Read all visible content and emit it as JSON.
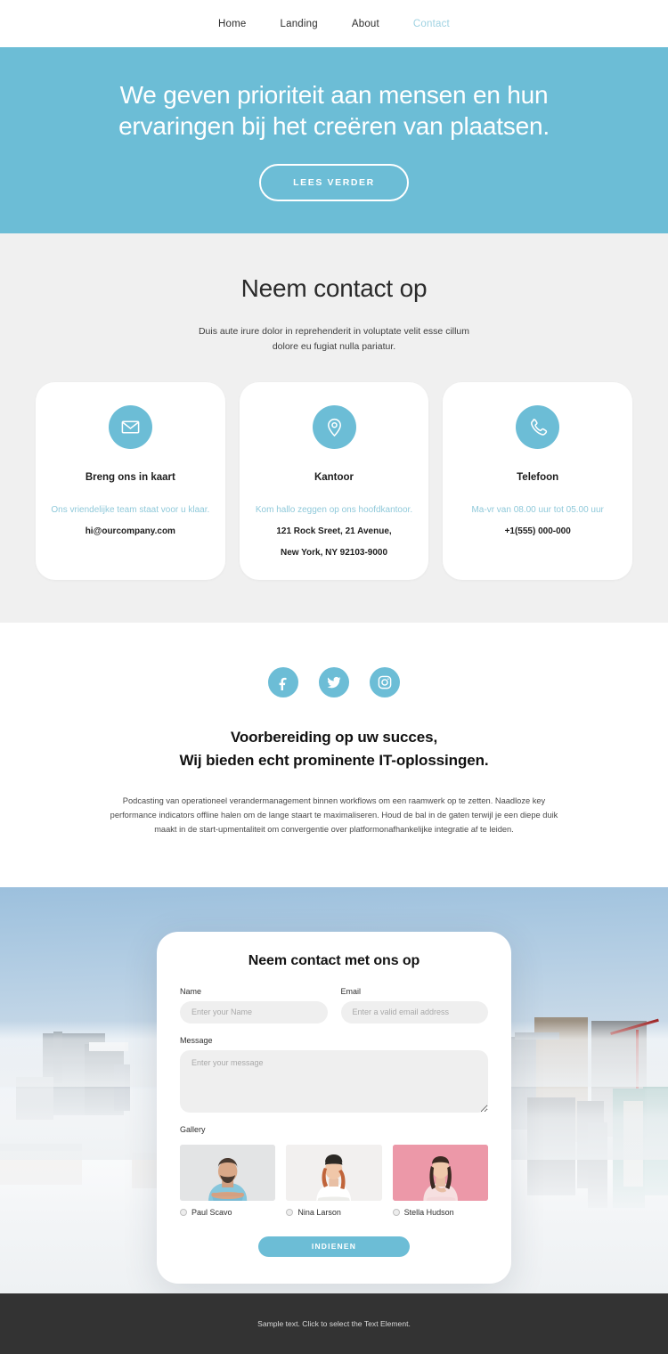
{
  "nav": {
    "items": [
      {
        "label": "Home",
        "active": false
      },
      {
        "label": "Landing",
        "active": false
      },
      {
        "label": "About",
        "active": false
      },
      {
        "label": "Contact",
        "active": true
      }
    ]
  },
  "hero": {
    "title": "We geven prioriteit aan mensen en hun ervaringen bij het creëren van plaatsen.",
    "button": "LEES VERDER",
    "bg_color": "#6cbdd6"
  },
  "contact": {
    "title": "Neem contact op",
    "subtitle": "Duis aute irure dolor in reprehenderit in voluptate velit esse cillum dolore eu fugiat nulla pariatur.",
    "cards": [
      {
        "icon": "envelope-icon",
        "title": "Breng ons in kaart",
        "sub": "Ons vriendelijke team staat voor u klaar.",
        "value": "hi@ourcompany.com",
        "value2": ""
      },
      {
        "icon": "map-pin-icon",
        "title": "Kantoor",
        "sub": "Kom hallo zeggen op ons hoofdkantoor.",
        "value": "121 Rock Sreet, 21 Avenue,",
        "value2": "New York, NY 92103-9000"
      },
      {
        "icon": "phone-icon",
        "title": "Telefoon",
        "sub": "Ma-vr van 08.00 uur tot 05.00 uur",
        "value": "+1(555) 000-000",
        "value2": ""
      }
    ]
  },
  "mid": {
    "socials": [
      {
        "icon": "facebook-icon",
        "name": "Facebook"
      },
      {
        "icon": "twitter-icon",
        "name": "Twitter"
      },
      {
        "icon": "instagram-icon",
        "name": "Instagram"
      }
    ],
    "title_line1": "Voorbereiding op uw succes,",
    "title_line2": "Wij bieden echt prominente IT-oplossingen.",
    "paragraph": "Podcasting van operationeel verandermanagement binnen workflows om een raamwerk op te zetten. Naadloze key performance indicators offline halen om de lange staart te maximaliseren. Houd de bal in de gaten terwijl je een diepe duik maakt in de start-upmentaliteit om convergentie over platformonafhankelijke integratie af te leiden."
  },
  "form": {
    "title": "Neem contact met ons op",
    "name_label": "Name",
    "name_placeholder": "Enter your Name",
    "name_value": "",
    "email_label": "Email",
    "email_placeholder": "Enter a valid email address",
    "email_value": "",
    "message_label": "Message",
    "message_placeholder": "Enter your message",
    "message_value": "",
    "gallery_label": "Gallery",
    "gallery": [
      {
        "name": "Paul Scavo",
        "bg": "#e2e3e4",
        "selected": false
      },
      {
        "name": "Nina Larson",
        "bg": "#f1efee",
        "selected": false
      },
      {
        "name": "Stella Hudson",
        "bg": "#eb97a7",
        "selected": false
      }
    ],
    "submit": "INDIENEN",
    "accent_color": "#6cbdd6"
  },
  "footer": {
    "text": "Sample text. Click to select the Text Element.",
    "bg_color": "#333333"
  }
}
